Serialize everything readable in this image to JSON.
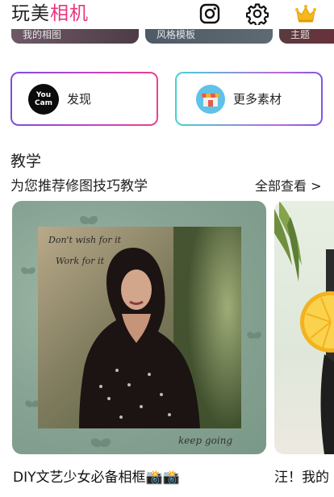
{
  "header": {
    "title_part1": "玩美",
    "title_part2": "相机",
    "icons": [
      "instagram-icon",
      "gear-icon",
      "crown-icon"
    ]
  },
  "top_cards": [
    "我的相图",
    "风格模板",
    "主题"
  ],
  "features": {
    "discover_label": "发现",
    "discover_logo_line1": "You",
    "discover_logo_line2": "Cam",
    "more_label": "更多素材"
  },
  "section": {
    "title": "教学",
    "subtitle": "为您推荐修图技巧教学",
    "see_all": "全部查看 >"
  },
  "cards": [
    {
      "caption": "DIY文艺少女必备相框📸📸",
      "overlay_text_1": "Don't wish for it",
      "overlay_text_2": "Work for it",
      "overlay_text_3": "keep going"
    },
    {
      "caption": "汪！我的"
    }
  ],
  "colors": {
    "accent_pink": "#e8367f",
    "discover_gradient": [
      "#7c4ddb",
      "#ee3f8a"
    ],
    "more_gradient": [
      "#42d3d5",
      "#7d58e2"
    ]
  }
}
